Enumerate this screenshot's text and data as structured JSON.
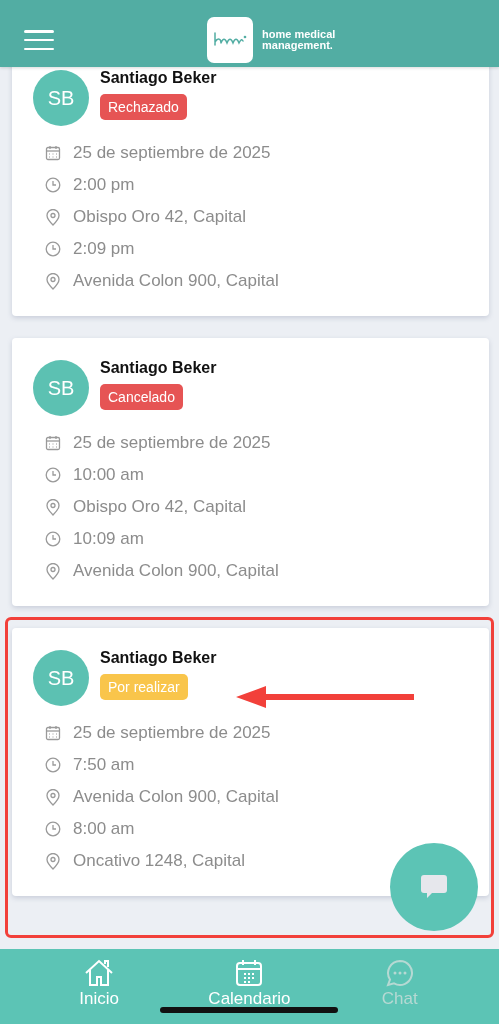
{
  "header": {
    "logo_text": "home medical management."
  },
  "appointments": [
    {
      "initials": "SB",
      "name": "Santiago Beker",
      "status": "Rechazado",
      "color": "#e65454",
      "highlighted": false,
      "details": [
        {
          "kind": "date",
          "text": "25 de septiembre de 2025"
        },
        {
          "kind": "time",
          "text": "2:00 pm"
        },
        {
          "kind": "place",
          "text": "Obispo Oro 42, Capital"
        },
        {
          "kind": "time",
          "text": "2:09 pm"
        },
        {
          "kind": "place",
          "text": "Avenida Colon 900, Capital"
        }
      ]
    },
    {
      "initials": "SB",
      "name": "Santiago Beker",
      "status": "Cancelado",
      "color": "#e65454",
      "highlighted": false,
      "details": [
        {
          "kind": "date",
          "text": "25 de septiembre de 2025"
        },
        {
          "kind": "time",
          "text": "10:00 am"
        },
        {
          "kind": "place",
          "text": "Obispo Oro 42, Capital"
        },
        {
          "kind": "time",
          "text": "10:09 am"
        },
        {
          "kind": "place",
          "text": "Avenida Colon 900, Capital"
        }
      ]
    },
    {
      "initials": "SB",
      "name": "Santiago Beker",
      "status": "Por realizar",
      "color": "#f9c54b",
      "highlighted": true,
      "details": [
        {
          "kind": "date",
          "text": "25 de septiembre de 2025"
        },
        {
          "kind": "time",
          "text": "7:50 am"
        },
        {
          "kind": "place",
          "text": "Avenida Colon 900, Capital"
        },
        {
          "kind": "time",
          "text": "8:00 am"
        },
        {
          "kind": "place",
          "text": "Oncativo 1248, Capital"
        }
      ]
    }
  ],
  "nav": [
    {
      "kind": "home",
      "label": "Inicio",
      "disabled": false
    },
    {
      "kind": "calendar",
      "label": "Calendario",
      "disabled": false
    },
    {
      "kind": "chat",
      "label": "Chat",
      "disabled": true
    }
  ]
}
